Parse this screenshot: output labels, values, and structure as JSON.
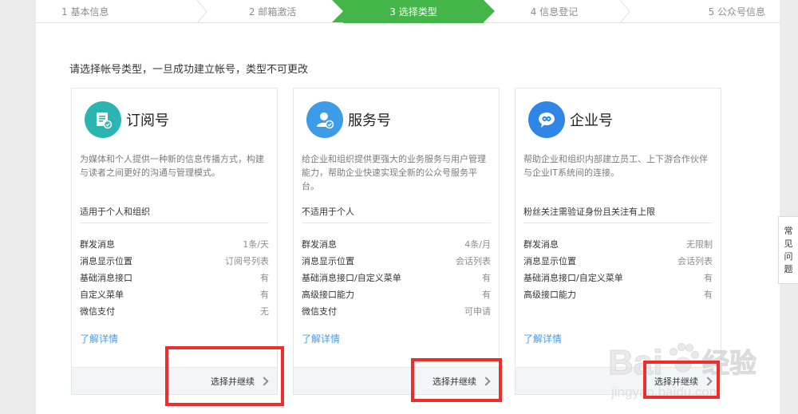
{
  "steps": [
    {
      "label": "1 基本信息",
      "state": "done"
    },
    {
      "label": "2 邮箱激活",
      "state": "done"
    },
    {
      "label": "3 选择类型",
      "state": "active"
    },
    {
      "label": "4 信息登记",
      "state": "todo"
    },
    {
      "label": "5 公众号信息",
      "state": "todo"
    }
  ],
  "instruction": "请选择帐号类型，一旦成功建立帐号，类型不可更改",
  "cards": [
    {
      "icon": "subscription-account-icon",
      "icon_color": "#2bb5b0",
      "name": "订阅号",
      "desc": "为媒体和个人提供一种新的信息传播方式，构建与读者之间更好的沟通与管理模式。",
      "suitable": "适用于个人和组织",
      "features": [
        {
          "k": "群发消息",
          "v": "1条/天"
        },
        {
          "k": "消息显示位置",
          "v": "订阅号列表"
        },
        {
          "k": "基础消息接口",
          "v": "有"
        },
        {
          "k": "自定义菜单",
          "v": "有"
        },
        {
          "k": "微信支付",
          "v": "无"
        }
      ],
      "more": "了解详情",
      "action": "选择并继续"
    },
    {
      "icon": "service-account-icon",
      "icon_color": "#3d9ce8",
      "name": "服务号",
      "desc": "给企业和组织提供更强大的业务服务与用户管理能力，帮助企业快速实现全新的公众号服务平台。",
      "suitable": "不适用于个人",
      "features": [
        {
          "k": "群发消息",
          "v": "4条/月"
        },
        {
          "k": "消息显示位置",
          "v": "会话列表"
        },
        {
          "k": "基础消息接口/自定义菜单",
          "v": "有"
        },
        {
          "k": "高级接口能力",
          "v": "有"
        },
        {
          "k": "微信支付",
          "v": "可申请"
        }
      ],
      "more": "了解详情",
      "action": "选择并继续"
    },
    {
      "icon": "enterprise-account-icon",
      "icon_color": "#2f86e6",
      "name": "企业号",
      "desc": "帮助企业和组织内部建立员工、上下游合作伙伴与企业IT系统间的连接。",
      "suitable": "粉丝关注需验证身份且关注有上限",
      "features": [
        {
          "k": "群发消息",
          "v": "无限制"
        },
        {
          "k": "消息显示位置",
          "v": "会话列表"
        },
        {
          "k": "基础消息接口/自定义菜单",
          "v": "有"
        },
        {
          "k": "高级接口能力",
          "v": "有"
        }
      ],
      "more": "了解详情",
      "action": "选择并继续"
    }
  ],
  "faq": [
    "常",
    "见",
    "问",
    "题"
  ],
  "watermark": {
    "brand": "Bai",
    "suffix": "经验",
    "url": "jingyan.baidu.com"
  },
  "colors": {
    "active_step": "#44b549",
    "link": "#459ae9",
    "highlight": "#ee2d2d"
  }
}
